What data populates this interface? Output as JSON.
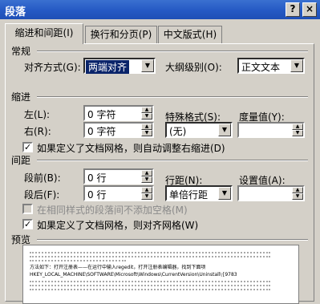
{
  "window": {
    "title": "段落",
    "help_btn": "?",
    "close_btn": "×"
  },
  "tabs": [
    {
      "label": "缩进和间距(I)",
      "active": true
    },
    {
      "label": "换行和分页(P)",
      "active": false
    },
    {
      "label": "中文版式(H)",
      "active": false
    }
  ],
  "general": {
    "section": "常规",
    "alignment_label": "对齐方式(G):",
    "alignment_value": "两端对齐",
    "outline_label": "大纲级别(O):",
    "outline_value": "正文文本"
  },
  "indent": {
    "section": "缩进",
    "left_label": "左(L):",
    "left_value": "0 字符",
    "right_label": "右(R):",
    "right_value": "0 字符",
    "special_label": "特殊格式(S):",
    "special_value": "(无)",
    "by_label": "度量值(Y):",
    "by_value": "",
    "auto_adjust_label": "如果定义了文档网格，则自动调整右缩进(D)",
    "auto_adjust_checked": true
  },
  "spacing": {
    "section": "间距",
    "before_label": "段前(B):",
    "before_value": "0 行",
    "after_label": "段后(F):",
    "after_value": "0 行",
    "line_label": "行距(N):",
    "line_value": "单倍行距",
    "at_label": "设置值(A):",
    "at_value": "",
    "no_space_label": "在相同样式的段落间不添加空格(M)",
    "no_space_checked": false,
    "snap_grid_label": "如果定义了文档网格，则对齐网格(W)",
    "snap_grid_checked": true
  },
  "preview": {
    "section": "预览",
    "text_line1": "方法如下：打开注册表——在运行中输入regedit，打开注册表编辑器，找到下面项",
    "text_line2": "HKEY_LOCAL_MACHINE\\SOFTWARE\\Microsoft\\Windows\\CurrentVersion\\Uninstall\\{9783"
  },
  "icons": {
    "dropdown": "chevron-down-icon",
    "checkmark": "✓"
  }
}
